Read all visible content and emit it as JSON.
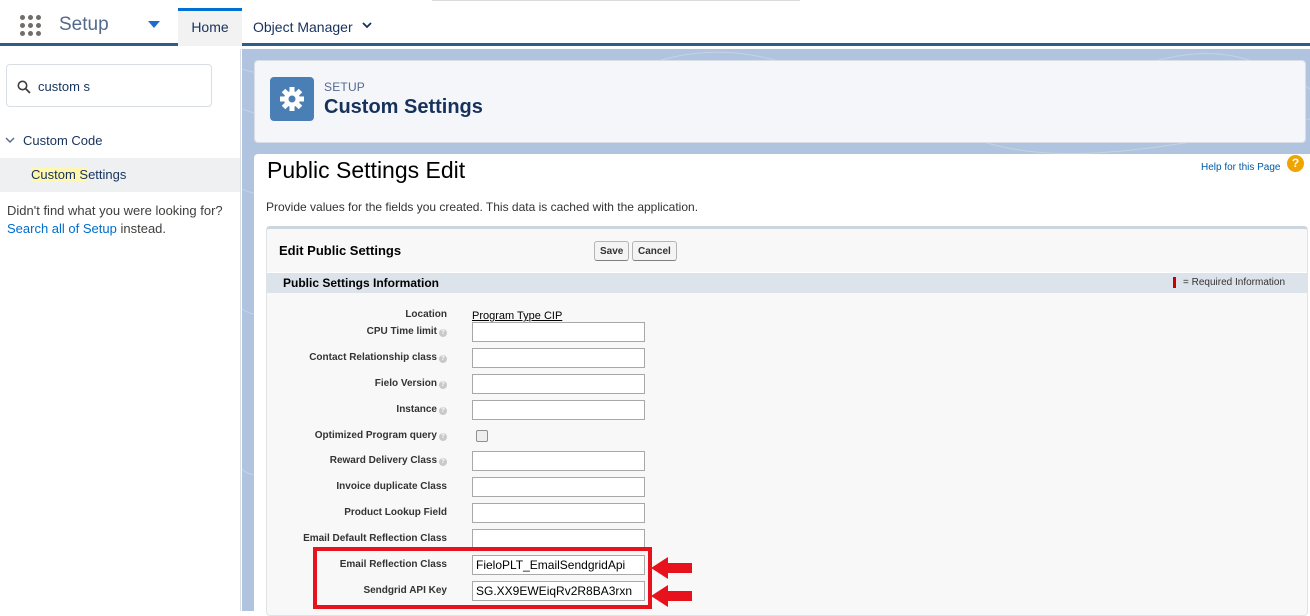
{
  "topbar": {
    "app_name": "Setup",
    "tabs": [
      {
        "label": "Home",
        "active": true
      },
      {
        "label": "Object Manager",
        "active": false
      }
    ],
    "accent_color": "#0070d2",
    "border_color": "#2e5d87"
  },
  "sidebar": {
    "search": {
      "value": "custom s",
      "placeholder": ""
    },
    "group": {
      "label": "Custom Code",
      "expanded": true
    },
    "item": {
      "label_highlight": "Custom S",
      "label_rest": "ettings",
      "selected": true
    },
    "not_found": {
      "prefix": "Didn't find what you were looking for?",
      "link": "Search all of Setup",
      "suffix": "instead."
    }
  },
  "header": {
    "breadcrumb": "SETUP",
    "title": "Custom Settings",
    "icon": "gear-icon"
  },
  "page": {
    "title": "Public Settings Edit",
    "help_link": "Help for this Page",
    "help_icon": "?",
    "description": "Provide values for the fields you created. This data is cached with the application."
  },
  "block": {
    "title": "Edit Public Settings",
    "save_label": "Save",
    "cancel_label": "Cancel",
    "section_title": "Public Settings Information",
    "required_text": "= Required Information"
  },
  "fields": {
    "location": {
      "label": "Location",
      "value": "Program Type CIP"
    },
    "cpu_time_limit": {
      "label": "CPU Time limit",
      "value": ""
    },
    "contact_relationship_class": {
      "label": "Contact Relationship class",
      "value": ""
    },
    "fielo_version": {
      "label": "Fielo Version",
      "value": ""
    },
    "instance": {
      "label": "Instance",
      "value": ""
    },
    "optimized_program_query": {
      "label": "Optimized Program query",
      "checked": false
    },
    "reward_delivery_class": {
      "label": "Reward Delivery Class",
      "value": ""
    },
    "invoice_duplicate_class": {
      "label": "Invoice duplicate Class",
      "value": ""
    },
    "product_lookup_field": {
      "label": "Product Lookup Field",
      "value": ""
    },
    "email_default_reflection_class": {
      "label": "Email Default Reflection Class",
      "value": ""
    },
    "email_reflection_class": {
      "label": "Email Reflection Class",
      "value": "FieloPLT_EmailSendgridApi"
    },
    "sendgrid_api_key": {
      "label": "Sendgrid API Key",
      "value": "SG.XX9EWEiqRv2R8BA3rxn"
    }
  },
  "annotation": {
    "color": "#e8121c"
  }
}
